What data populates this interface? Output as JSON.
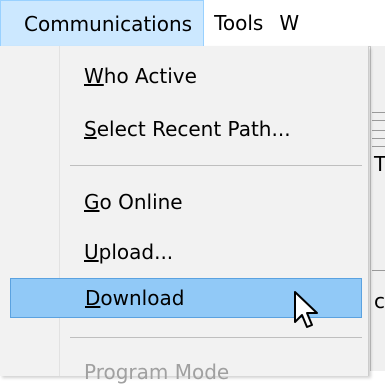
{
  "menubar": {
    "items": [
      {
        "label": "Communications"
      },
      {
        "label": "Tools"
      },
      {
        "label": "W"
      }
    ]
  },
  "menu": {
    "items": [
      {
        "mnemonic": "W",
        "rest": "ho Active"
      },
      {
        "mnemonic": "S",
        "rest": "elect Recent Path..."
      },
      {
        "mnemonic": "G",
        "rest": "o Online"
      },
      {
        "mnemonic": "U",
        "rest": "pload..."
      },
      {
        "mnemonic": "D",
        "rest": "ownload"
      },
      {
        "mnemonic": "",
        "rest": "Program Mode"
      }
    ],
    "highlighted_index": 4
  },
  "background_window": {
    "fragments": [
      "T",
      "c"
    ]
  },
  "colors": {
    "menubar_active_bg": "#cce8ff",
    "highlight_bg": "#91c9f7",
    "highlight_border": "#5ba2e0",
    "menu_bg": "#f2f2f2",
    "disabled_text": "#a0a0a0"
  },
  "cursor": {
    "icon": "arrow-pointer-icon"
  }
}
